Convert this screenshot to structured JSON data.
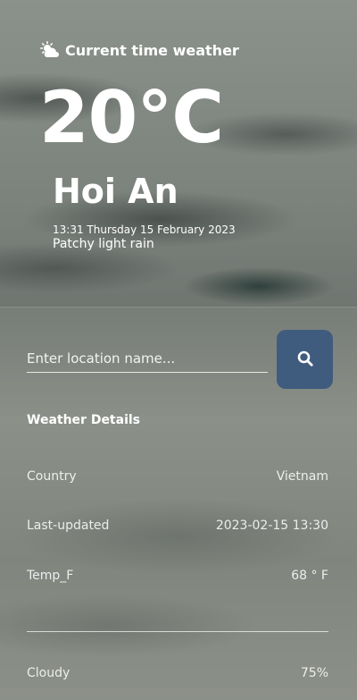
{
  "header": {
    "title": "Current time weather",
    "icon": "sun-cloud-icon"
  },
  "current": {
    "temperature": "20°C",
    "city": "Hoi An",
    "datetime": "13:31 Thursday 15 February 2023",
    "condition": "Patchy light rain"
  },
  "search": {
    "placeholder": "Enter location name...",
    "value": "",
    "button_icon": "search-icon",
    "button_color": "#3f5c7e"
  },
  "details": {
    "title": "Weather Details",
    "rows": [
      {
        "label": "Country",
        "value": "Vietnam"
      },
      {
        "label": "Last-updated",
        "value": "2023-02-15 13:30"
      },
      {
        "label": "Temp_F",
        "value": "68 ° F"
      }
    ],
    "extra_rows": [
      {
        "label": "Cloudy",
        "value": "75%"
      }
    ]
  }
}
